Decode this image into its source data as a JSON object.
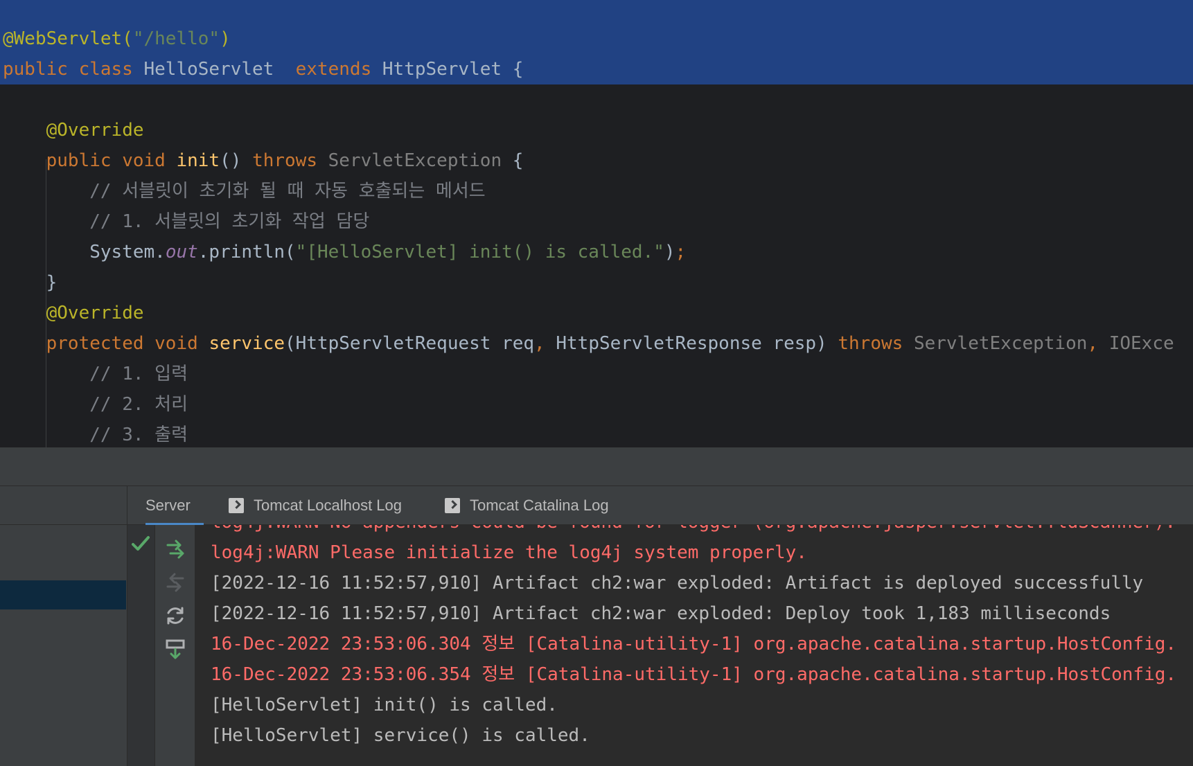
{
  "editor": {
    "lines": [
      {
        "tokens": [
          {
            "c": "tok-ann",
            "t": "@WebServlet("
          },
          {
            "c": "tok-str",
            "t": "\"/hello\""
          },
          {
            "c": "tok-ann",
            "t": ")"
          }
        ]
      },
      {
        "tokens": [
          {
            "c": "tok-kw",
            "t": "public class "
          },
          {
            "c": "tok-cls",
            "t": "HelloServlet  "
          },
          {
            "c": "tok-kw",
            "t": "extends "
          },
          {
            "c": "tok-cls",
            "t": "HttpServlet {"
          }
        ]
      },
      {
        "tokens": []
      },
      {
        "tokens": [
          {
            "c": "tok-plain",
            "t": "    "
          },
          {
            "c": "tok-ann",
            "t": "@Override"
          }
        ]
      },
      {
        "tokens": [
          {
            "c": "tok-plain",
            "t": "    "
          },
          {
            "c": "tok-kw",
            "t": "public void "
          },
          {
            "c": "tok-fn",
            "t": "init"
          },
          {
            "c": "tok-plain",
            "t": "() "
          },
          {
            "c": "tok-kw",
            "t": "throws "
          },
          {
            "c": "tok-dim",
            "t": "ServletException "
          },
          {
            "c": "tok-plain",
            "t": "{"
          }
        ]
      },
      {
        "tokens": [
          {
            "c": "tok-plain",
            "t": "        "
          },
          {
            "c": "tok-cmt",
            "t": "// 서블릿이 초기화 될 때 자동 호출되는 메서드"
          }
        ]
      },
      {
        "tokens": [
          {
            "c": "tok-plain",
            "t": "        "
          },
          {
            "c": "tok-cmt",
            "t": "// 1. 서블릿의 초기화 작업 담당"
          }
        ]
      },
      {
        "tokens": [
          {
            "c": "tok-plain",
            "t": "        System."
          },
          {
            "c": "tok-field",
            "t": "out"
          },
          {
            "c": "tok-plain",
            "t": ".println("
          },
          {
            "c": "tok-str",
            "t": "\"[HelloServlet] init() is called.\""
          },
          {
            "c": "tok-plain",
            "t": ")"
          },
          {
            "c": "tok-kw",
            "t": ";"
          }
        ]
      },
      {
        "tokens": [
          {
            "c": "tok-plain",
            "t": "    }"
          }
        ]
      },
      {
        "tokens": [
          {
            "c": "tok-plain",
            "t": "    "
          },
          {
            "c": "tok-ann",
            "t": "@Override"
          }
        ]
      },
      {
        "tokens": [
          {
            "c": "tok-plain",
            "t": "    "
          },
          {
            "c": "tok-kw",
            "t": "protected void "
          },
          {
            "c": "tok-fn",
            "t": "service"
          },
          {
            "c": "tok-plain",
            "t": "(HttpServletRequest req"
          },
          {
            "c": "tok-kw",
            "t": ", "
          },
          {
            "c": "tok-plain",
            "t": "HttpServletResponse resp) "
          },
          {
            "c": "tok-kw",
            "t": "throws "
          },
          {
            "c": "tok-dim",
            "t": "ServletException"
          },
          {
            "c": "tok-kw",
            "t": ", "
          },
          {
            "c": "tok-dim",
            "t": "IOExce"
          }
        ]
      },
      {
        "tokens": [
          {
            "c": "tok-plain",
            "t": "        "
          },
          {
            "c": "tok-cmt",
            "t": "// 1. 입력"
          }
        ]
      },
      {
        "tokens": [
          {
            "c": "tok-plain",
            "t": "        "
          },
          {
            "c": "tok-cmt",
            "t": "// 2. 처리"
          }
        ]
      },
      {
        "tokens": [
          {
            "c": "tok-plain",
            "t": "        "
          },
          {
            "c": "tok-cmt",
            "t": "// 3. 출력"
          }
        ]
      }
    ]
  },
  "tool_window": {
    "tabs": [
      {
        "label": "Server",
        "icon": "none",
        "active": true
      },
      {
        "label": "Tomcat Localhost Log",
        "icon": "log-icon",
        "active": false
      },
      {
        "label": "Tomcat Catalina Log",
        "icon": "log-icon",
        "active": false
      }
    ]
  },
  "console": {
    "lines": [
      {
        "style": "log-red",
        "text": "log4j:WARN Please initialize the log4j system properly."
      },
      {
        "style": "log-plain",
        "text": "[2022-12-16 11:52:57,910] Artifact ch2:war exploded: Artifact is deployed successfully"
      },
      {
        "style": "log-plain",
        "text": "[2022-12-16 11:52:57,910] Artifact ch2:war exploded: Deploy took 1,183 milliseconds"
      },
      {
        "style": "log-red",
        "text": "16-Dec-2022 23:53:06.304 정보 [Catalina-utility-1] org.apache.catalina.startup.HostConfig."
      },
      {
        "style": "log-red",
        "text": "16-Dec-2022 23:53:06.354 정보 [Catalina-utility-1] org.apache.catalina.startup.HostConfig."
      },
      {
        "style": "log-plain",
        "text": "[HelloServlet] init() is called."
      },
      {
        "style": "log-plain",
        "text": "[HelloServlet] service() is called."
      }
    ]
  },
  "colors": {
    "selection": "#214283",
    "editor_bg": "#1e1f22",
    "keyword": "#cc7832",
    "annotation": "#bbb529",
    "string": "#6a8759",
    "error_log": "#ff6b68",
    "success_check": "#59a869"
  }
}
